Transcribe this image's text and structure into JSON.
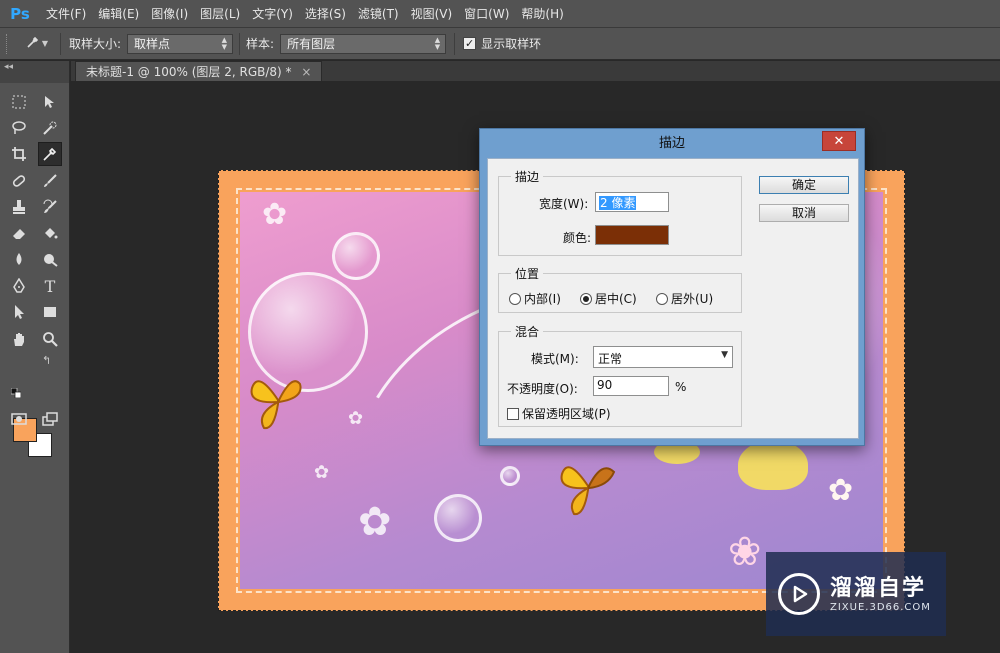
{
  "app": {
    "logo": "Ps"
  },
  "menubar": [
    "文件(F)",
    "编辑(E)",
    "图像(I)",
    "图层(L)",
    "文字(Y)",
    "选择(S)",
    "滤镜(T)",
    "视图(V)",
    "窗口(W)",
    "帮助(H)"
  ],
  "options_bar": {
    "tool_icon": "eyedropper-icon",
    "sample_size_label": "取样大小:",
    "sample_size_value": "取样点",
    "sample_label": "样本:",
    "sample_value": "所有图层",
    "show_ring_label": "显示取样环",
    "show_ring_checked": true
  },
  "document_tab": {
    "title": "未标题-1 @ 100% (图层 2, RGB/8) *",
    "close": "×"
  },
  "toolbox": {
    "header": "◂◂",
    "foreground_color": "#f9a35c",
    "background_color": "#ffffff"
  },
  "stroke_dialog": {
    "title": "描边",
    "close": "✕",
    "stroke_group": {
      "legend": "描边",
      "width_label": "宽度(W):",
      "width_value": "2 像素",
      "color_label": "颜色:",
      "color_value": "#7b2f06"
    },
    "location_group": {
      "legend": "位置",
      "options": [
        "内部(I)",
        "居中(C)",
        "居外(U)"
      ],
      "selected": "居中(C)"
    },
    "blending_group": {
      "legend": "混合",
      "mode_label": "模式(M):",
      "mode_value": "正常",
      "opacity_label": "不透明度(O):",
      "opacity_value": "90",
      "opacity_unit": "%",
      "preserve_label": "保留透明区域(P)",
      "preserve_checked": false
    },
    "ok_label": "确定",
    "cancel_label": "取消"
  },
  "watermark": {
    "title": "溜溜自学",
    "subtitle": "ZIXUE.3D66.COM"
  },
  "colors": {
    "menu_bg": "#535353",
    "workspace_bg": "#282828",
    "dialog_frame": "#6f9fcf",
    "frame_orange": "#f9a35c"
  }
}
